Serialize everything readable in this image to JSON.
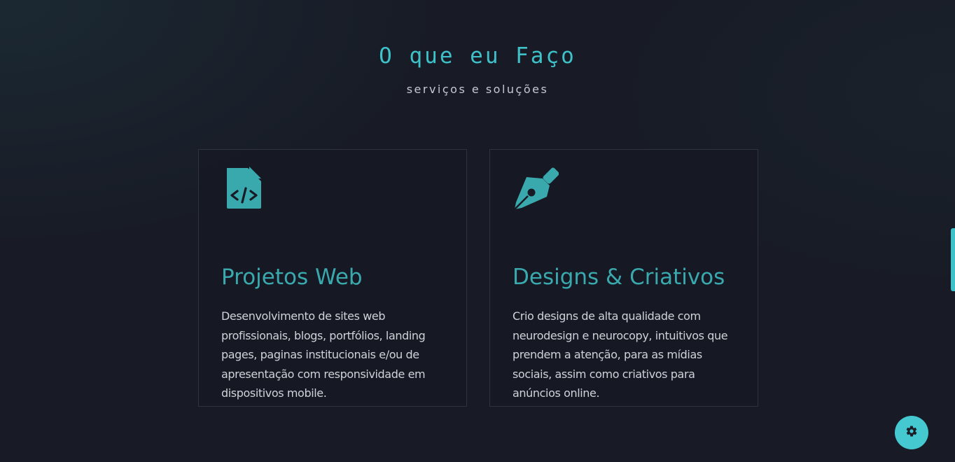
{
  "section": {
    "title": "O que eu Faço",
    "subtitle": "serviços e soluções"
  },
  "services": [
    {
      "icon": "file-code-icon",
      "title": "Projetos Web",
      "description": "Desenvolvimento de sites web profissionais, blogs, portfólios, landing pages, paginas institucionais e/ou de apresentação com responsividade em dispositivos mobile."
    },
    {
      "icon": "pen-nib-icon",
      "title": "Designs & Criativos",
      "description": "Crio designs de alta qualidade com neurodesign e neurocopy, intuitivos que prendem a atenção, para as mídias sociais, assim como criativos para anúncios online."
    }
  ],
  "settings_button": {
    "icon": "gear-icon"
  },
  "colors": {
    "background": "#181b26",
    "accent": "#3ec1c8",
    "card_title": "#3aa9ae",
    "card_border": "#2f3340",
    "text": "#cfd2d9"
  }
}
